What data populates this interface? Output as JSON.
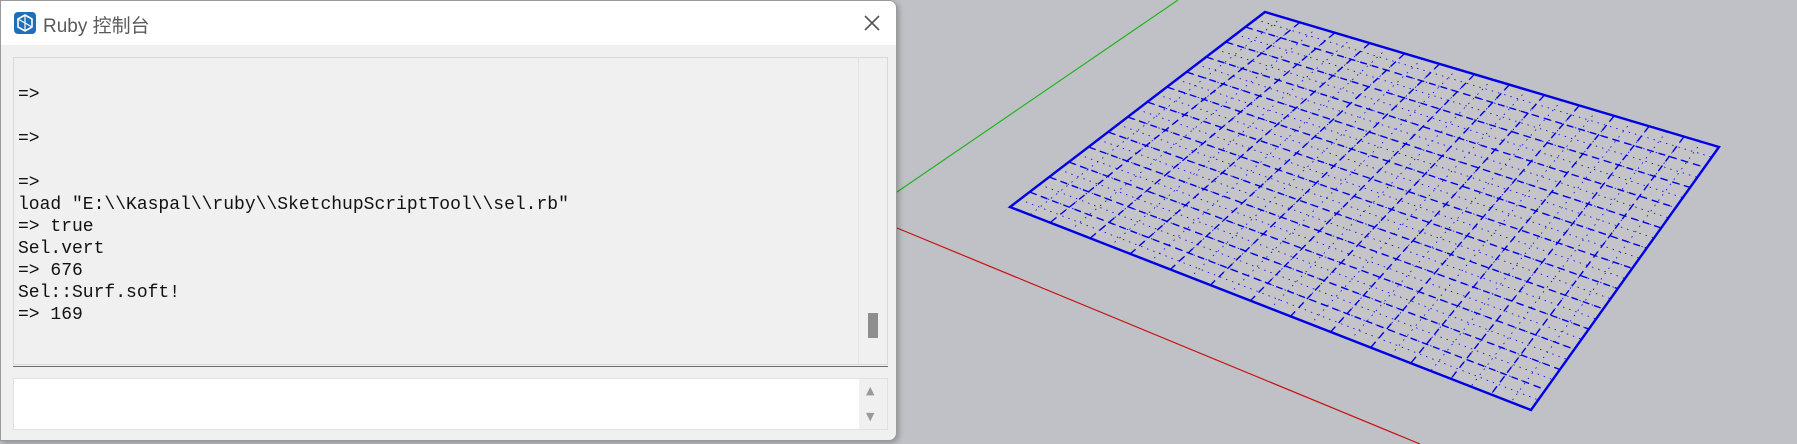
{
  "window": {
    "title": "Ruby 控制台",
    "icon": "sketchup-logo-icon",
    "close_icon": "close-icon"
  },
  "console": {
    "output_lines": [
      "=>",
      "",
      "=>",
      "",
      "=>",
      "load \"E:\\\\Kaspal\\\\ruby\\\\SketchupScriptTool\\\\sel.rb\"",
      "=> true",
      "Sel.vert",
      "=> 676",
      "Sel::Surf.soft!",
      "=> 169"
    ],
    "input_value": ""
  },
  "colors": {
    "viewport_background": "#c0c1c6",
    "selection_edges": "#0000e6",
    "green_axis": "#1fb51f",
    "red_axis": "#c41414",
    "sketchup_brand": "#1f6fb8"
  }
}
